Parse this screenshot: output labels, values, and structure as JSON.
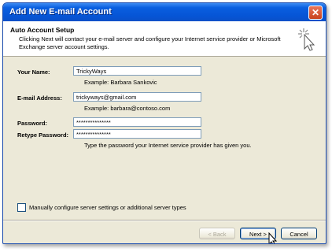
{
  "window": {
    "title": "Add New E-mail Account"
  },
  "header": {
    "title": "Auto Account Setup",
    "description": "Clicking Next will contact your e-mail server and configure your Internet service provider or Microsoft Exchange server account settings."
  },
  "form": {
    "name_label": "Your Name:",
    "name_value": "TrickyWays",
    "name_hint": "Example: Barbara Sankovic",
    "email_label": "E-mail Address:",
    "email_value": "trickyways@gmail.com",
    "email_hint": "Example: barbara@contoso.com",
    "password_label": "Password:",
    "password_value": "***************",
    "retype_label": "Retype Password:",
    "retype_value": "***************",
    "password_hint": "Type the password your Internet service provider has given you."
  },
  "manual_config": {
    "label": "Manually configure server settings or additional server types",
    "checked": false
  },
  "buttons": {
    "back": "< Back",
    "next": "Next >",
    "cancel": "Cancel"
  },
  "icons": {
    "close": "close-icon",
    "wizard": "wand-icon",
    "cursor": "mouse-pointer-icon"
  },
  "colors": {
    "titlebar": "#0655d6",
    "dialog_bg": "#ece9d8",
    "close": "#c8431f"
  }
}
